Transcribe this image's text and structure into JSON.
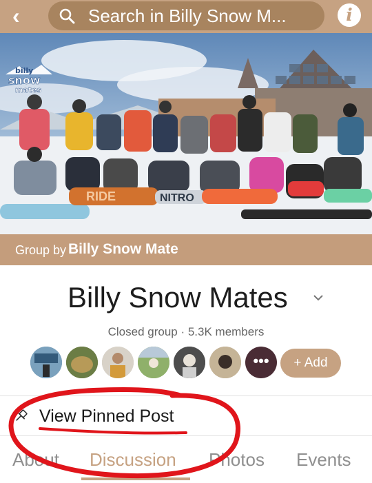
{
  "header": {
    "back_glyph": "‹",
    "search_placeholder": "Search in Billy Snow M...",
    "info_glyph": "i"
  },
  "cover": {
    "logo_lines": [
      "billy",
      "snow",
      "mates"
    ],
    "board_brands": [
      "RIDE",
      "NITRO"
    ]
  },
  "group": {
    "by_prefix": "Group by",
    "by_name": "Billy Snow Mate",
    "name": "Billy Snow Mates",
    "meta": "Closed group · 5.3K members",
    "more_glyph": "•••",
    "add_label": "+ Add"
  },
  "pinned": {
    "label": "View Pinned Post"
  },
  "tabs": [
    {
      "label": "About"
    },
    {
      "label": "Discussion"
    },
    {
      "label": "Photos"
    },
    {
      "label": "Events"
    }
  ],
  "colors": {
    "brand": "#c6a282",
    "search_pill": "#a8845f",
    "annotation": "#e0151b"
  }
}
